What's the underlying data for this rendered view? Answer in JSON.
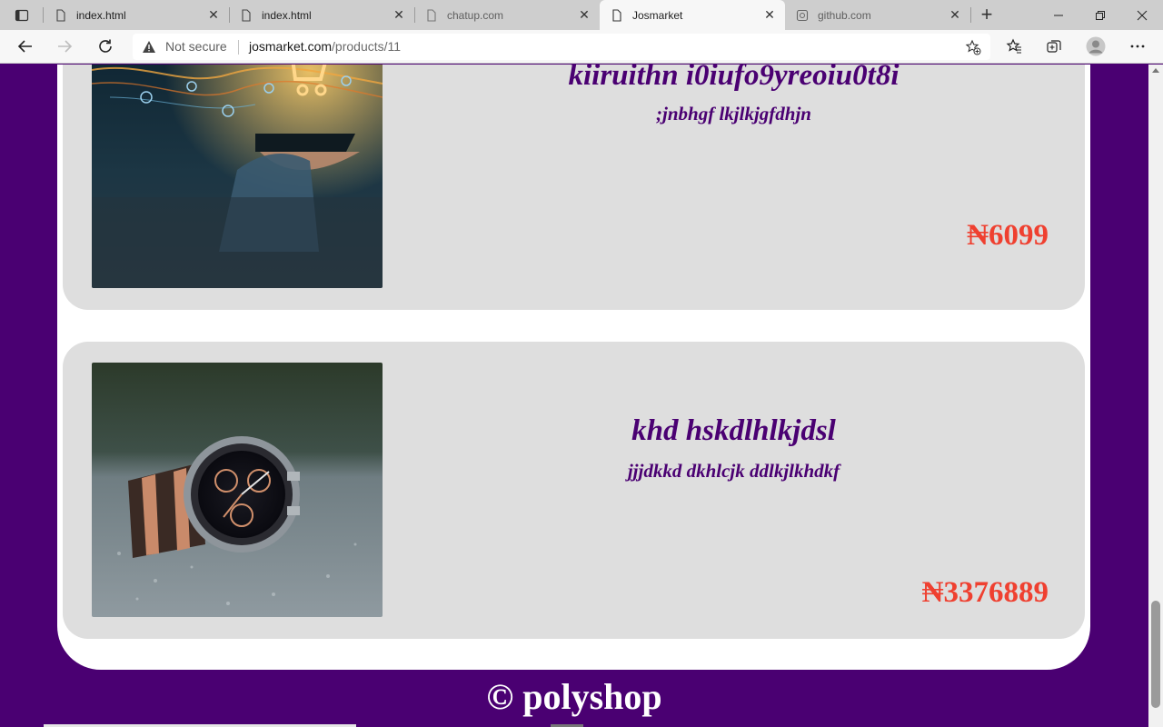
{
  "browser": {
    "tabs": [
      {
        "title": "index.html",
        "favicon": "page-icon",
        "active": false
      },
      {
        "title": "index.html",
        "favicon": "page-icon",
        "active": false
      },
      {
        "title": "chatup.com",
        "favicon": "page-icon",
        "active": false
      },
      {
        "title": "Josmarket",
        "favicon": "page-icon",
        "active": true
      },
      {
        "title": "github.com",
        "favicon": "github-icon",
        "active": false
      }
    ],
    "address_bar": {
      "security_label": "Not secure",
      "host": "josmarket.com",
      "path": "/products/11"
    }
  },
  "page": {
    "products": [
      {
        "name": "kiiruithn i0iufo9yreoiu0t8i",
        "description": ";jnbhgf lkjlkjgfdhjn",
        "price": "₦6099",
        "image": "ecommerce-tablet-image"
      },
      {
        "name": "khd hskdlhlkjdsl",
        "description": "jjjdkkd dkhlcjk ddlkjlkhdkf",
        "price": "₦3376889",
        "image": "wristwatch-image"
      }
    ],
    "footer": "© polyshop"
  },
  "colors": {
    "brand_purple": "#4a0072",
    "card_bg": "#dedede",
    "price_red": "#ef4030"
  }
}
